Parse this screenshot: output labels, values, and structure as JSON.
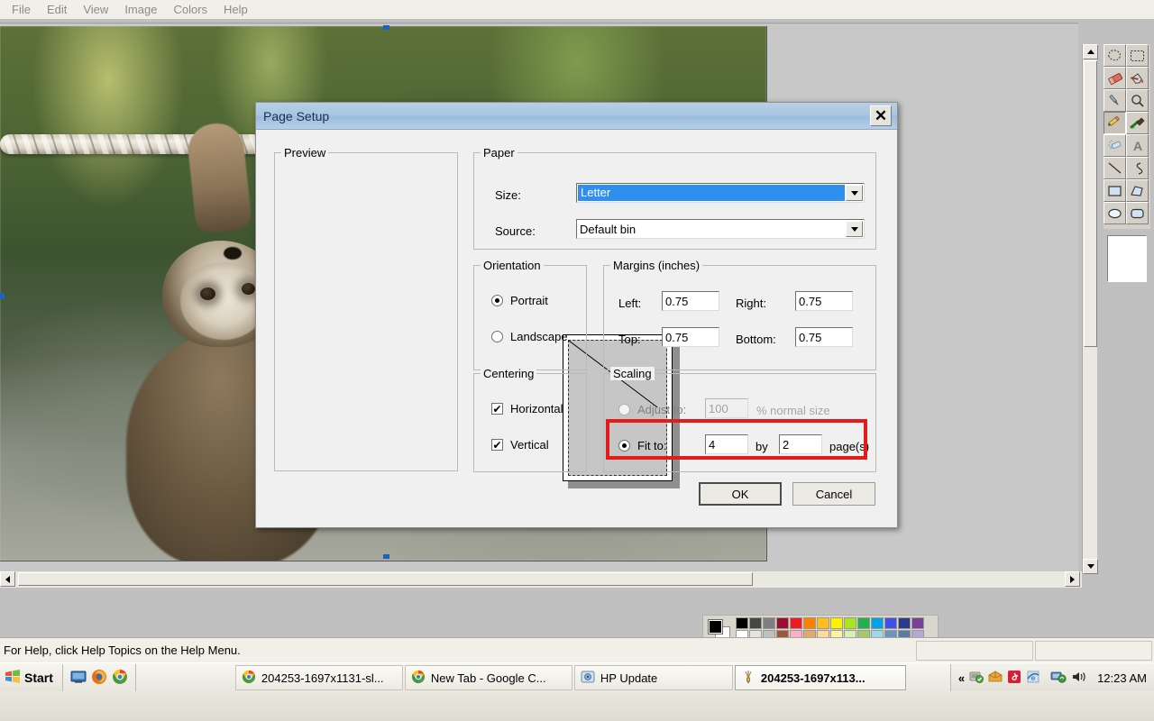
{
  "menubar": {
    "items": [
      "File",
      "Edit",
      "View",
      "Image",
      "Colors",
      "Help"
    ]
  },
  "statusbar": {
    "text": "For Help, click Help Topics on the Help Menu."
  },
  "toolbox": {
    "tools": [
      {
        "name": "free-form-select",
        "selected": false
      },
      {
        "name": "rectangle-select",
        "selected": false
      },
      {
        "name": "eraser",
        "selected": false
      },
      {
        "name": "fill-with-color",
        "selected": false
      },
      {
        "name": "pick-color",
        "selected": false
      },
      {
        "name": "magnifier",
        "selected": false
      },
      {
        "name": "pencil",
        "selected": true
      },
      {
        "name": "brush",
        "selected": false
      },
      {
        "name": "airbrush",
        "selected": false
      },
      {
        "name": "text",
        "selected": false
      },
      {
        "name": "line",
        "selected": false
      },
      {
        "name": "curve",
        "selected": false
      },
      {
        "name": "rectangle",
        "selected": false
      },
      {
        "name": "polygon",
        "selected": false
      },
      {
        "name": "ellipse",
        "selected": false
      },
      {
        "name": "rounded-rectangle",
        "selected": false
      }
    ]
  },
  "palette": {
    "foreground": "#000000",
    "background": "#ffffff",
    "row1": [
      "#000000",
      "#464646",
      "#7f7f7f",
      "#99002e",
      "#ed1c24",
      "#ff7f27",
      "#ffb countedd",
      "#fff200",
      "#a8e61d",
      "#22b14c",
      "#00a2e8",
      "#3f48cc",
      "#2b3a8f",
      "#7a3f99"
    ],
    "row2": [
      "#ffffff",
      "#e3e3e3",
      "#bfbfbf",
      "#9c5a3c",
      "#ffaec9",
      "#e2a96a",
      "#ffd9a0",
      "#fdf0a8",
      "#d9f0b0",
      "#a3c96b",
      "#99d9ea",
      "#7092be",
      "#5a7ba6",
      "#b6a7d8"
    ]
  },
  "dialog": {
    "title": "Page Setup",
    "close_label": "✕",
    "preview": {
      "legend": "Preview"
    },
    "paper": {
      "legend": "Paper",
      "size_label": "Size:",
      "size_value": "Letter",
      "source_label": "Source:",
      "source_value": "Default bin"
    },
    "orientation": {
      "legend": "Orientation",
      "portrait_label": "Portrait",
      "landscape_label": "Landscape",
      "selected": "Portrait"
    },
    "margins": {
      "legend": "Margins (inches)",
      "left_label": "Left:",
      "left_value": "0.75",
      "right_label": "Right:",
      "right_value": "0.75",
      "top_label": "Top:",
      "top_value": "0.75",
      "bottom_label": "Bottom:",
      "bottom_value": "0.75"
    },
    "centering": {
      "legend": "Centering",
      "horizontal_label": "Horizontal",
      "horizontal_checked": true,
      "vertical_label": "Vertical",
      "vertical_checked": true,
      "check_glyph": "✔"
    },
    "scaling": {
      "legend": "Scaling",
      "adjust_label": "Adjust to:",
      "adjust_value": "100",
      "adjust_suffix": "% normal size",
      "adjust_selected": false,
      "fit_label": "Fit to:",
      "fit_wide_value": "4",
      "fit_by_label": "by",
      "fit_tall_value": "2",
      "fit_suffix": "page(s)",
      "fit_selected": true,
      "highlight_color": "#e51b1b"
    },
    "buttons": {
      "ok": "OK",
      "cancel": "Cancel"
    }
  },
  "taskbar": {
    "start_label": "Start",
    "quicklaunch": [
      "show-desktop-icon",
      "firefox-icon",
      "chrome-icon"
    ],
    "tasks": [
      {
        "label": "204253-1697x1131-sl...",
        "icon": "chrome-icon",
        "active": false
      },
      {
        "label": "New Tab - Google C...",
        "icon": "chrome-icon",
        "active": false
      },
      {
        "label": "HP Update",
        "icon": "hp-update-icon",
        "active": false
      },
      {
        "label": "204253-1697x113...",
        "icon": "paint-icon",
        "active": true
      }
    ],
    "tray": {
      "expand_glyph": "«",
      "icons": [
        "antivirus-icon",
        "updates-icon",
        "adobe-icon",
        "internet-explorer-icon",
        "network-icon",
        "volume-icon"
      ],
      "time": "12:23 AM"
    }
  }
}
